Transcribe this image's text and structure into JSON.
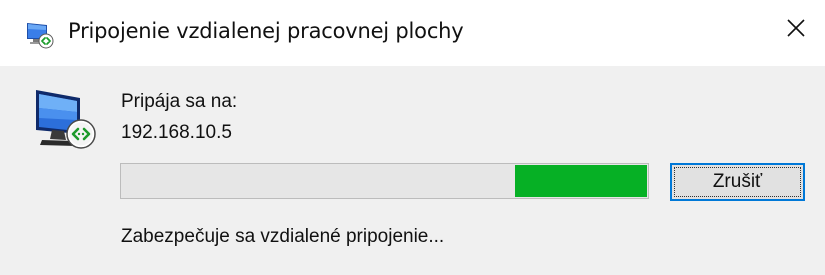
{
  "window": {
    "title": "Pripojenie vzdialenej pracovnej plochy",
    "title_icon": "remote-desktop-icon",
    "close_icon": "close-icon"
  },
  "dialog": {
    "connecting_label": "Pripája sa na:",
    "address": "192.168.10.5",
    "status_text": "Zabezpečuje sa vzdialené pripojenie...",
    "cancel_label": "Zrušiť",
    "large_icon": "remote-desktop-computer-icon",
    "progress": {
      "style": "marquee",
      "fill_color": "#06b025"
    }
  },
  "colors": {
    "content_background": "#f0f0f0",
    "accent_focus": "#0078d7"
  }
}
